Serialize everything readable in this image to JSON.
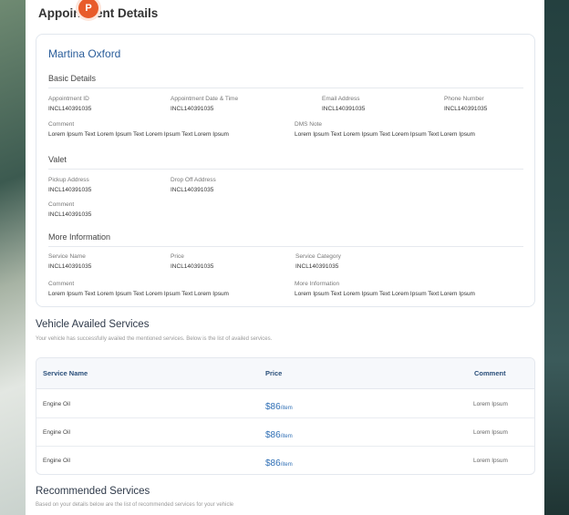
{
  "page": {
    "title": "Appointment Details",
    "avatar_initial": "P"
  },
  "customer": {
    "name": "Martina Oxford"
  },
  "basic_details": {
    "heading": "Basic Details",
    "fields": {
      "appointment_id": {
        "label": "Appointment ID",
        "value": "INCL140391035"
      },
      "appointment_datetime": {
        "label": "Appointment Date & Time",
        "value": "INCL140391035"
      },
      "email": {
        "label": "Email Address",
        "value": "INCL140391035"
      },
      "phone": {
        "label": "Phone Number",
        "value": "INCL140391035"
      },
      "comment": {
        "label": "Comment",
        "value": "Lorem Ipsum Text Lorem Ipsum Text Lorem Ipsum Text Lorem Ipsum"
      },
      "dms_note": {
        "label": "DMS Note",
        "value": "Lorem Ipsum Text Lorem Ipsum Text Lorem Ipsum Text Lorem Ipsum"
      }
    }
  },
  "valet": {
    "heading": "Valet",
    "fields": {
      "pickup": {
        "label": "Pickup Address",
        "value": "INCL140391035"
      },
      "dropoff": {
        "label": "Drop Off Address",
        "value": "INCL140391035"
      },
      "comment": {
        "label": "Comment",
        "value": "INCL140391035"
      }
    }
  },
  "more_info": {
    "heading": "More Information",
    "fields": {
      "service_name": {
        "label": "Service Name",
        "value": "INCL140391035"
      },
      "price": {
        "label": "Price",
        "value": "INCL140391035"
      },
      "service_category": {
        "label": "Service Category",
        "value": "INCL140391035"
      },
      "comment": {
        "label": "Comment",
        "value": "Lorem Ipsum Text Lorem Ipsum Text Lorem Ipsum Text Lorem Ipsum"
      },
      "more_information": {
        "label": "More Information",
        "value": "Lorem Ipsum Text Lorem Ipsum Text Lorem Ipsum Text Lorem Ipsum"
      }
    }
  },
  "availed_services": {
    "title": "Vehicle Availed Services",
    "subtitle": "Your vehicle has successfully availed the mentioned services. Below is the list of availed services.",
    "columns": [
      "Service Name",
      "Price",
      "Comment"
    ],
    "rows": [
      {
        "name": "Engine Oil",
        "price": "$86",
        "unit": "/item",
        "comment": "Lorem Ipsum"
      },
      {
        "name": "Engine Oil",
        "price": "$86",
        "unit": "/item",
        "comment": "Lorem Ipsum"
      },
      {
        "name": "Engine Oil",
        "price": "$86",
        "unit": "/item",
        "comment": "Lorem Ipsum"
      }
    ]
  },
  "recommended_services": {
    "title": "Recommended Services",
    "subtitle": "Based on your details below are the list of recommended services for your vehicle"
  },
  "colors": {
    "accent_blue": "#2a5d9a",
    "price_blue": "#2f6fb5",
    "badge_orange": "#e85b2a"
  }
}
